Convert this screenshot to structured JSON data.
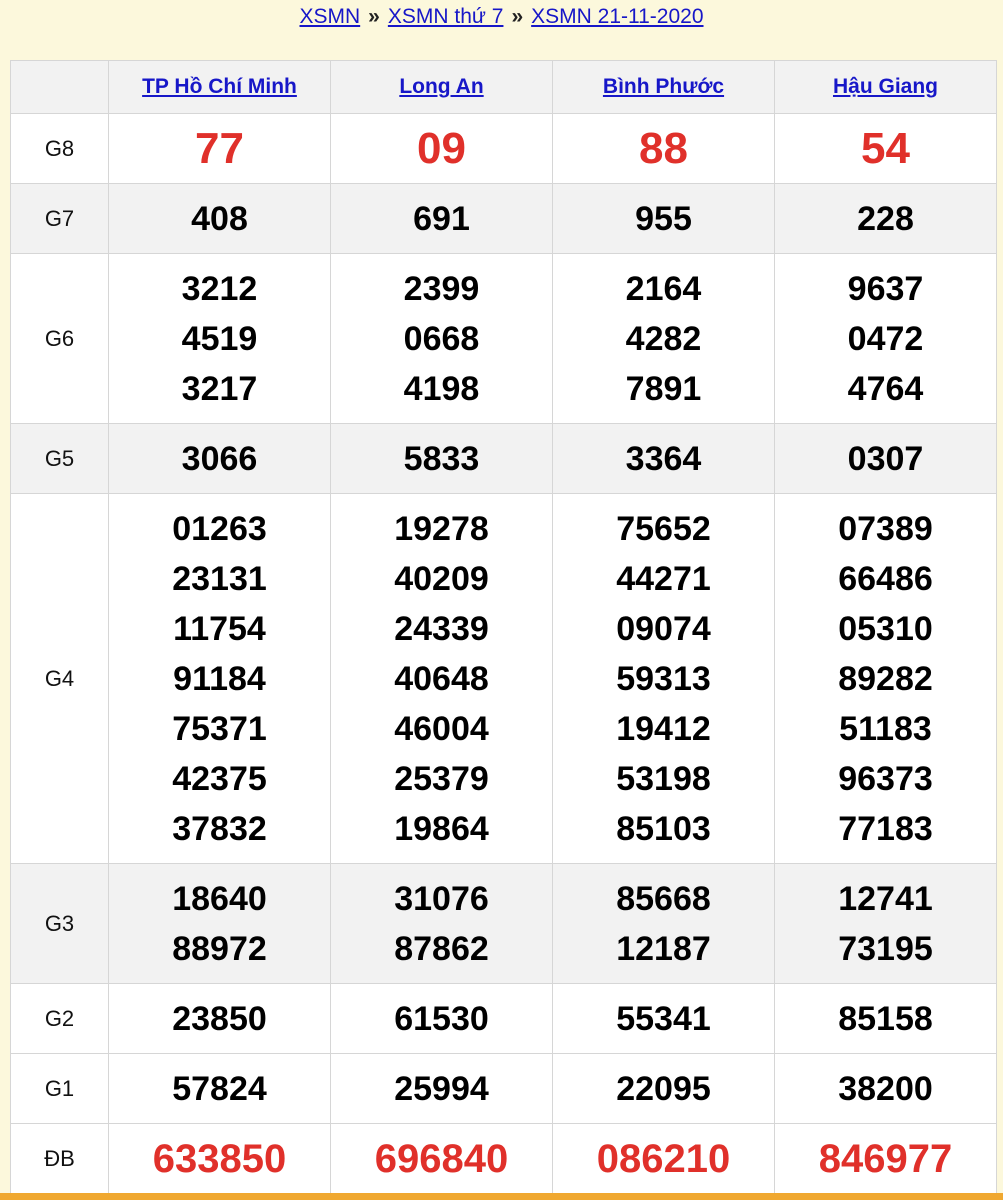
{
  "breadcrumb": {
    "items": [
      "XSMN",
      "XSMN thứ 7",
      "XSMN 21-11-2020"
    ],
    "separator": "»"
  },
  "provinces": [
    "TP Hồ Chí Minh",
    "Long An",
    "Bình Phước",
    "Hậu Giang"
  ],
  "prizes": [
    {
      "label": "G8",
      "values": [
        [
          "77"
        ],
        [
          "09"
        ],
        [
          "88"
        ],
        [
          "54"
        ]
      ]
    },
    {
      "label": "G7",
      "values": [
        [
          "408"
        ],
        [
          "691"
        ],
        [
          "955"
        ],
        [
          "228"
        ]
      ]
    },
    {
      "label": "G6",
      "values": [
        [
          "3212",
          "4519",
          "3217"
        ],
        [
          "2399",
          "0668",
          "4198"
        ],
        [
          "2164",
          "4282",
          "7891"
        ],
        [
          "9637",
          "0472",
          "4764"
        ]
      ]
    },
    {
      "label": "G5",
      "values": [
        [
          "3066"
        ],
        [
          "5833"
        ],
        [
          "3364"
        ],
        [
          "0307"
        ]
      ]
    },
    {
      "label": "G4",
      "values": [
        [
          "01263",
          "23131",
          "11754",
          "91184",
          "75371",
          "42375",
          "37832"
        ],
        [
          "19278",
          "40209",
          "24339",
          "40648",
          "46004",
          "25379",
          "19864"
        ],
        [
          "75652",
          "44271",
          "09074",
          "59313",
          "19412",
          "53198",
          "85103"
        ],
        [
          "07389",
          "66486",
          "05310",
          "89282",
          "51183",
          "96373",
          "77183"
        ]
      ]
    },
    {
      "label": "G3",
      "values": [
        [
          "18640",
          "88972"
        ],
        [
          "31076",
          "87862"
        ],
        [
          "85668",
          "12187"
        ],
        [
          "12741",
          "73195"
        ]
      ]
    },
    {
      "label": "G2",
      "values": [
        [
          "23850"
        ],
        [
          "61530"
        ],
        [
          "55341"
        ],
        [
          "85158"
        ]
      ]
    },
    {
      "label": "G1",
      "values": [
        [
          "57824"
        ],
        [
          "25994"
        ],
        [
          "22095"
        ],
        [
          "38200"
        ]
      ]
    },
    {
      "label": "ĐB",
      "values": [
        [
          "633850"
        ],
        [
          "696840"
        ],
        [
          "086210"
        ],
        [
          "846977"
        ]
      ]
    }
  ],
  "colors": {
    "accent_red": "#e0302a",
    "link_blue": "#1717c8",
    "banner_bg": "#fcf8dc",
    "row_shade": "#f2f2f2"
  }
}
